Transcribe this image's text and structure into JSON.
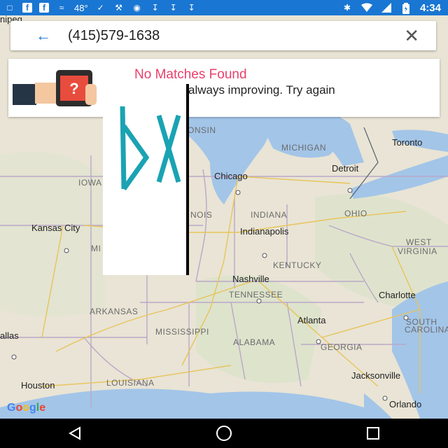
{
  "status_bar": {
    "temperature": "48°",
    "time": "4:34",
    "left_icons": [
      "chat-icon",
      "facebook-icon",
      "facebook-icon",
      "wind-icon",
      "temperature",
      "run-icon",
      "wrench-icon",
      "camera-icon",
      "download-icon",
      "download-icon",
      "download-icon"
    ],
    "right_icons": [
      "bluetooth-icon",
      "wifi-icon",
      "signal-icon",
      "battery-icon"
    ]
  },
  "search": {
    "value": "(415)579-1638"
  },
  "result": {
    "title": "No Matches Found",
    "message": "always improving. Try again"
  },
  "map": {
    "labels": {
      "nipeg": "nipeg",
      "onsin": "ONSIN",
      "michigan": "MICHIGAN",
      "toronto": "Toronto",
      "iowa": "IOWA",
      "chicago": "Chicago",
      "detroit": "Detroit",
      "kansas_city": "Kansas City",
      "nois": "NOIS",
      "indiana": "INDIANA",
      "ohio": "OHIO",
      "indianapolis": "Indianapolis",
      "mi": "MI",
      "west_virginia_1": "WEST",
      "west_virginia_2": "VIRGINIA",
      "kentucky": "KENTUCKY",
      "nashville": "Nashville",
      "tennessee": "TENNESSEE",
      "charlotte": "Charlotte",
      "arkansas": "ARKANSAS",
      "atlanta": "Atlanta",
      "south_carolina_1": "SOUTH",
      "south_carolina_2": "CAROLINA",
      "mississippi": "MISSISSIPPI",
      "dallas": "allas",
      "alabama": "ALABAMA",
      "georgia": "GEORGIA",
      "houston": "Houston",
      "louisiana": "LOUISIANA",
      "jacksonville": "Jacksonville",
      "orlando": "Orlando"
    },
    "logo": "Google",
    "water_color": "#a3c5e8",
    "land_color": "#ebe6d8"
  },
  "colors": {
    "accent": "#1976d2",
    "error_title": "#e9406a"
  }
}
